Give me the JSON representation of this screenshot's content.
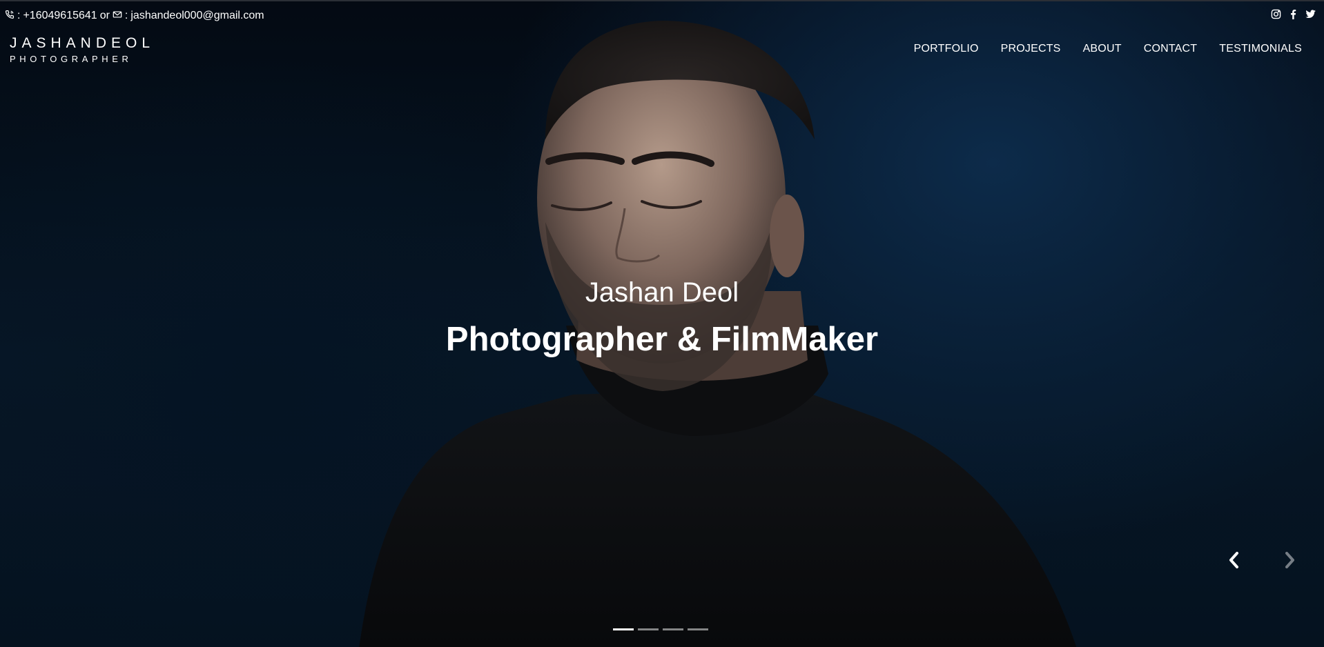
{
  "topbar": {
    "phone": "+16049615641",
    "separator": "or",
    "email": "jashandeol000@gmail.com",
    "phone_prefix": ":",
    "email_prefix": ":",
    "social_icons": [
      "instagram-icon",
      "facebook-icon",
      "twitter-icon"
    ]
  },
  "logo": {
    "name": "JASHANDEOL",
    "subtitle": "PHOTOGRAPHER"
  },
  "nav": {
    "items": [
      "PORTFOLIO",
      "PROJECTS",
      "ABOUT",
      "CONTACT",
      "TESTIMONIALS"
    ]
  },
  "hero": {
    "name": "Jashan Deol",
    "title": "Photographer & FilmMaker"
  },
  "carousel": {
    "slide_count": 4,
    "active_index": 0,
    "prev_icon": "chevron-left-icon",
    "next_icon": "chevron-right-icon"
  },
  "colors": {
    "background": "#03080f",
    "accent_blue": "#0d2b4a",
    "text": "#ffffff"
  }
}
